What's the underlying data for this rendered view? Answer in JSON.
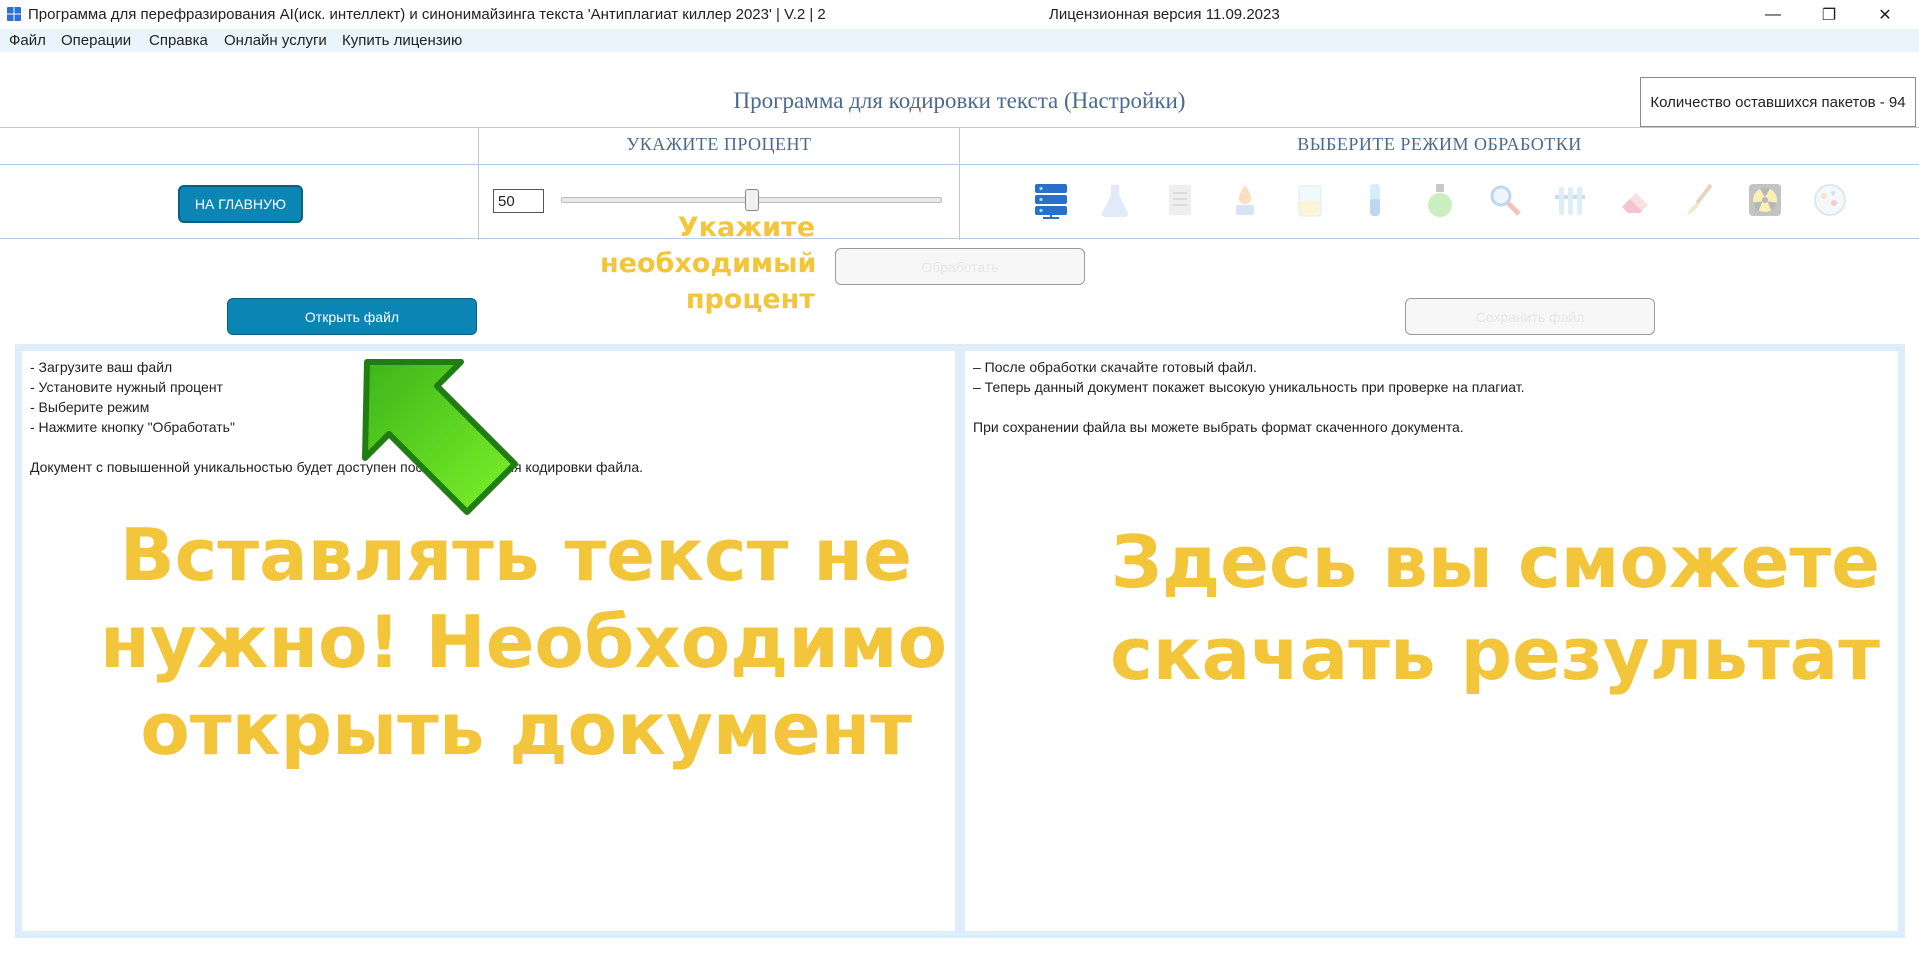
{
  "window": {
    "title": "Программа для перефразирования AI(иск. интеллект) и синонимайзинга текста 'Антиплагиат киллер 2023' | V.2 | 2",
    "license": "Лицензионная версия 11.09.2023",
    "controls": {
      "minimize": "—",
      "maximize": "❐",
      "close": "✕"
    }
  },
  "menu": {
    "items": [
      "Файл",
      "Операции",
      "Справка",
      "Онлайн услуги",
      "Купить лицензию"
    ]
  },
  "header": {
    "title": "Программа для кодировки текста (Настройки)",
    "packets": "Количество оставшихся пакетов - 94"
  },
  "settings": {
    "percent_header": "УКАЖИТЕ ПРОЦЕНТ",
    "mode_header": "ВЫБЕРИТЕ РЕЖИМ ОБРАБОТКИ",
    "home_button": "НА ГЛАВНУЮ",
    "percent_value": "50",
    "slider_fraction": 0.5,
    "mode_icons": [
      "server-rack-icon",
      "flask-icon",
      "document-icon",
      "burner-icon",
      "beaker-icon",
      "test-tube-icon",
      "bottle-icon",
      "magnifier-icon",
      "test-tubes-rack-icon",
      "eraser-icon",
      "brush-icon",
      "radiation-icon",
      "petri-dish-icon"
    ]
  },
  "hints": {
    "percent": "Укажите необходимый процент",
    "left_big": "Вставлять текст не нужно! Необходимо открыть документ",
    "right_big": "Здесь вы сможете скачать результат"
  },
  "buttons": {
    "process": "Обработать",
    "open": "Открыть файл",
    "save": "Сохранить файл"
  },
  "left_panel": {
    "lines": [
      "- Загрузите ваш файл",
      "- Установите нужный процент",
      "- Выберите режим",
      "- Нажмите кнопку \"Обработать\"",
      "",
      "Документ с повышенной уникальностью будет доступен после завершения кодировки файла."
    ]
  },
  "right_panel": {
    "lines": [
      "– После обработки скачайте готовый файл.",
      "– Теперь данный документ покажет высокую уникальность при проверке на плагиат.",
      "",
      "При сохранении файла вы можете выбрать формат скаченного документа."
    ]
  },
  "colors": {
    "accent": "#0b86b4",
    "hint": "#f2c53a",
    "header_text": "#4a6b8f",
    "menubar": "#e9f4fb",
    "arrow": "#5fd11d"
  }
}
